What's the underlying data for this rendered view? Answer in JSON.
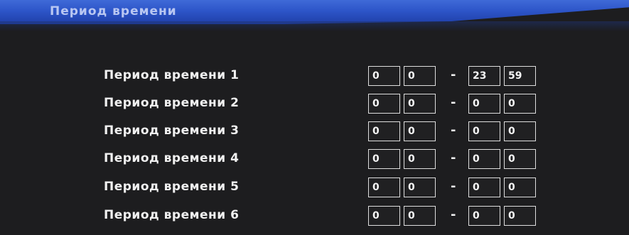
{
  "header": {
    "title": "Период времени"
  },
  "periods": [
    {
      "label": "Период времени 1",
      "start_hour": "0",
      "start_min": "0",
      "end_hour": "23",
      "end_min": "59"
    },
    {
      "label": "Период времени 2",
      "start_hour": "0",
      "start_min": "0",
      "end_hour": "0",
      "end_min": "0"
    },
    {
      "label": "Период времени 3",
      "start_hour": "0",
      "start_min": "0",
      "end_hour": "0",
      "end_min": "0"
    },
    {
      "label": "Период времени 4",
      "start_hour": "0",
      "start_min": "0",
      "end_hour": "0",
      "end_min": "0"
    },
    {
      "label": "Период времени 5",
      "start_hour": "0",
      "start_min": "0",
      "end_hour": "0",
      "end_min": "0"
    },
    {
      "label": "Период времени 6",
      "start_hour": "0",
      "start_min": "0",
      "end_hour": "0",
      "end_min": "0"
    }
  ],
  "separator": "-"
}
